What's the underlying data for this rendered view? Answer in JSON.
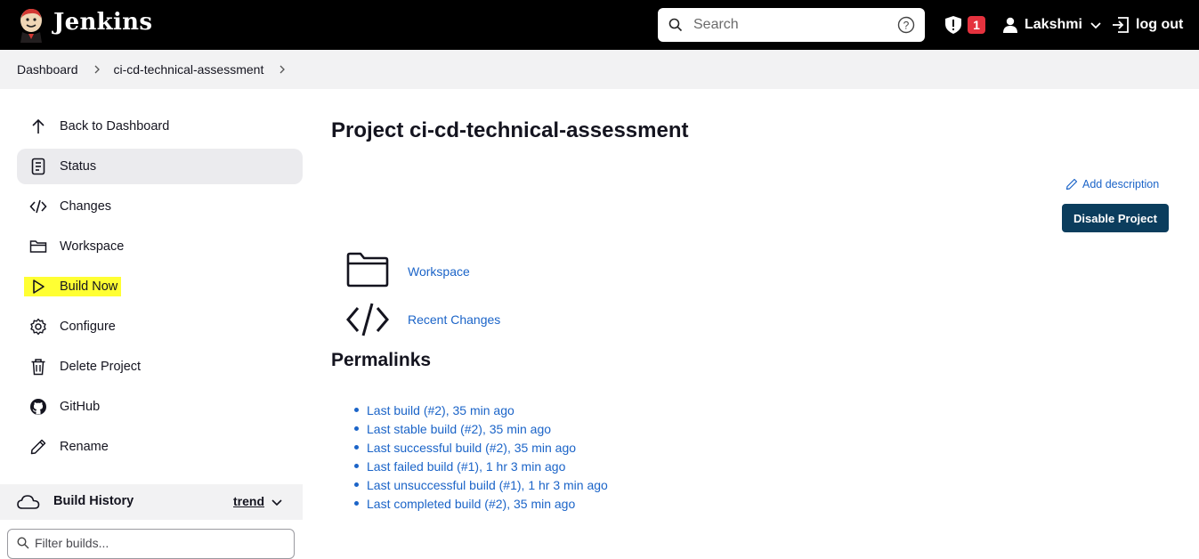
{
  "header": {
    "brand": "Jenkins",
    "search_placeholder": "Search",
    "security_badge_count": "1",
    "user_name": "Lakshmi",
    "logout_label": "log out"
  },
  "breadcrumb": {
    "items": [
      "Dashboard",
      "ci-cd-technical-assessment"
    ]
  },
  "sidebar": {
    "items": [
      {
        "label": "Back to Dashboard",
        "icon": "arrow-up-icon"
      },
      {
        "label": "Status",
        "icon": "document-icon"
      },
      {
        "label": "Changes",
        "icon": "code-icon"
      },
      {
        "label": "Workspace",
        "icon": "folder-icon"
      },
      {
        "label": "Build Now",
        "icon": "play-icon"
      },
      {
        "label": "Configure",
        "icon": "gear-icon"
      },
      {
        "label": "Delete Project",
        "icon": "trash-icon"
      },
      {
        "label": "GitHub",
        "icon": "github-icon"
      },
      {
        "label": "Rename",
        "icon": "pencil-icon"
      }
    ],
    "build_history": {
      "title": "Build History",
      "trend_label": "trend",
      "filter_placeholder": "Filter builds..."
    }
  },
  "main": {
    "title": "Project ci-cd-technical-assessment",
    "add_description": "Add description",
    "disable_button": "Disable Project",
    "links": [
      {
        "label": "Workspace",
        "icon": "folder-icon"
      },
      {
        "label": "Recent Changes",
        "icon": "code-icon"
      }
    ],
    "permalinks_title": "Permalinks",
    "permalinks": [
      "Last build (#2), 35 min ago",
      "Last stable build (#2), 35 min ago",
      "Last successful build (#2), 35 min ago",
      "Last failed build (#1), 1 hr 3 min ago",
      "Last unsuccessful build (#1), 1 hr 3 min ago",
      "Last completed build (#2), 35 min ago"
    ]
  },
  "colors": {
    "header_bg": "#000000",
    "link": "#1b64c8",
    "primary_button": "#0b3d5d",
    "highlight": "#ffff33",
    "badge": "#e5323e"
  }
}
